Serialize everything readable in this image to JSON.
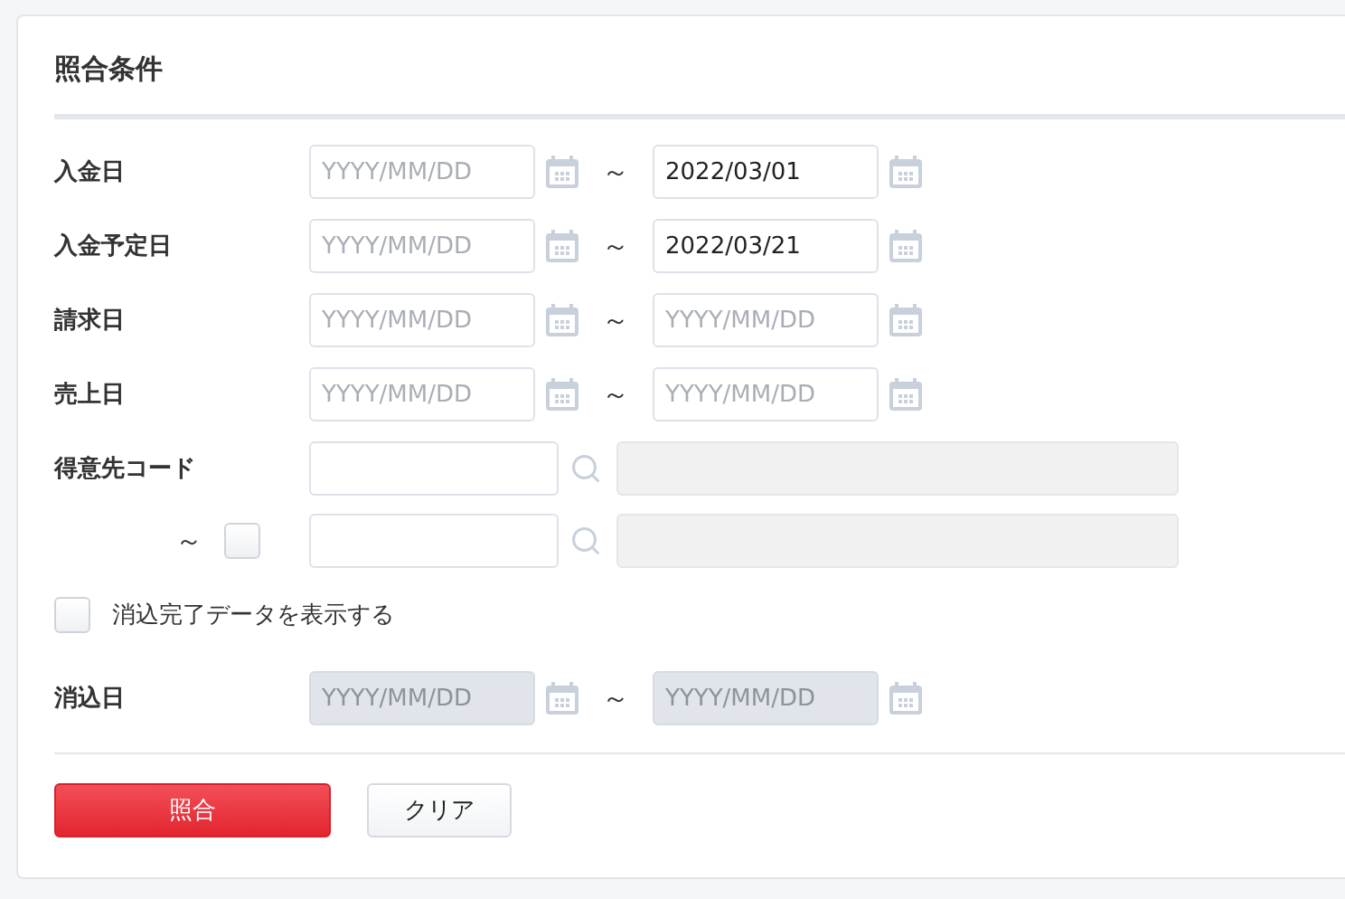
{
  "title": "照合条件",
  "rows": [
    {
      "kind": "date_range",
      "label": "入金日",
      "range_mark": "～",
      "from": {
        "placeholder": "YYYY/MM/DD",
        "disabled": false
      },
      "to": {
        "value": "2022/03/01",
        "disabled": false
      }
    },
    {
      "kind": "date_range",
      "label": "入金予定日",
      "range_mark": "～",
      "from": {
        "placeholder": "YYYY/MM/DD",
        "disabled": false
      },
      "to": {
        "value": "2022/03/21",
        "disabled": false
      }
    },
    {
      "kind": "date_range",
      "label": "請求日",
      "range_mark": "～",
      "from": {
        "placeholder": "YYYY/MM/DD",
        "disabled": false
      },
      "to": {
        "placeholder": "YYYY/MM/DD",
        "disabled": false
      }
    },
    {
      "kind": "date_range",
      "label": "売上日",
      "range_mark": "～",
      "from": {
        "placeholder": "YYYY/MM/DD",
        "disabled": false
      },
      "to": {
        "placeholder": "YYYY/MM/DD",
        "disabled": false
      }
    },
    {
      "kind": "code",
      "label": "得意先コード"
    },
    {
      "kind": "code_to",
      "range_mark": "～",
      "checked": false
    },
    {
      "kind": "checkbox",
      "label": "消込完了データを表示する",
      "checked": false
    },
    {
      "kind": "date_range",
      "label": "消込日",
      "range_mark": "～",
      "from": {
        "placeholder": "YYYY/MM/DD",
        "disabled": true
      },
      "to": {
        "placeholder": "YYYY/MM/DD",
        "disabled": true
      }
    }
  ],
  "buttons": [
    {
      "kind": "primary",
      "label": "照合"
    },
    {
      "kind": "secondary",
      "label": "クリア"
    }
  ]
}
